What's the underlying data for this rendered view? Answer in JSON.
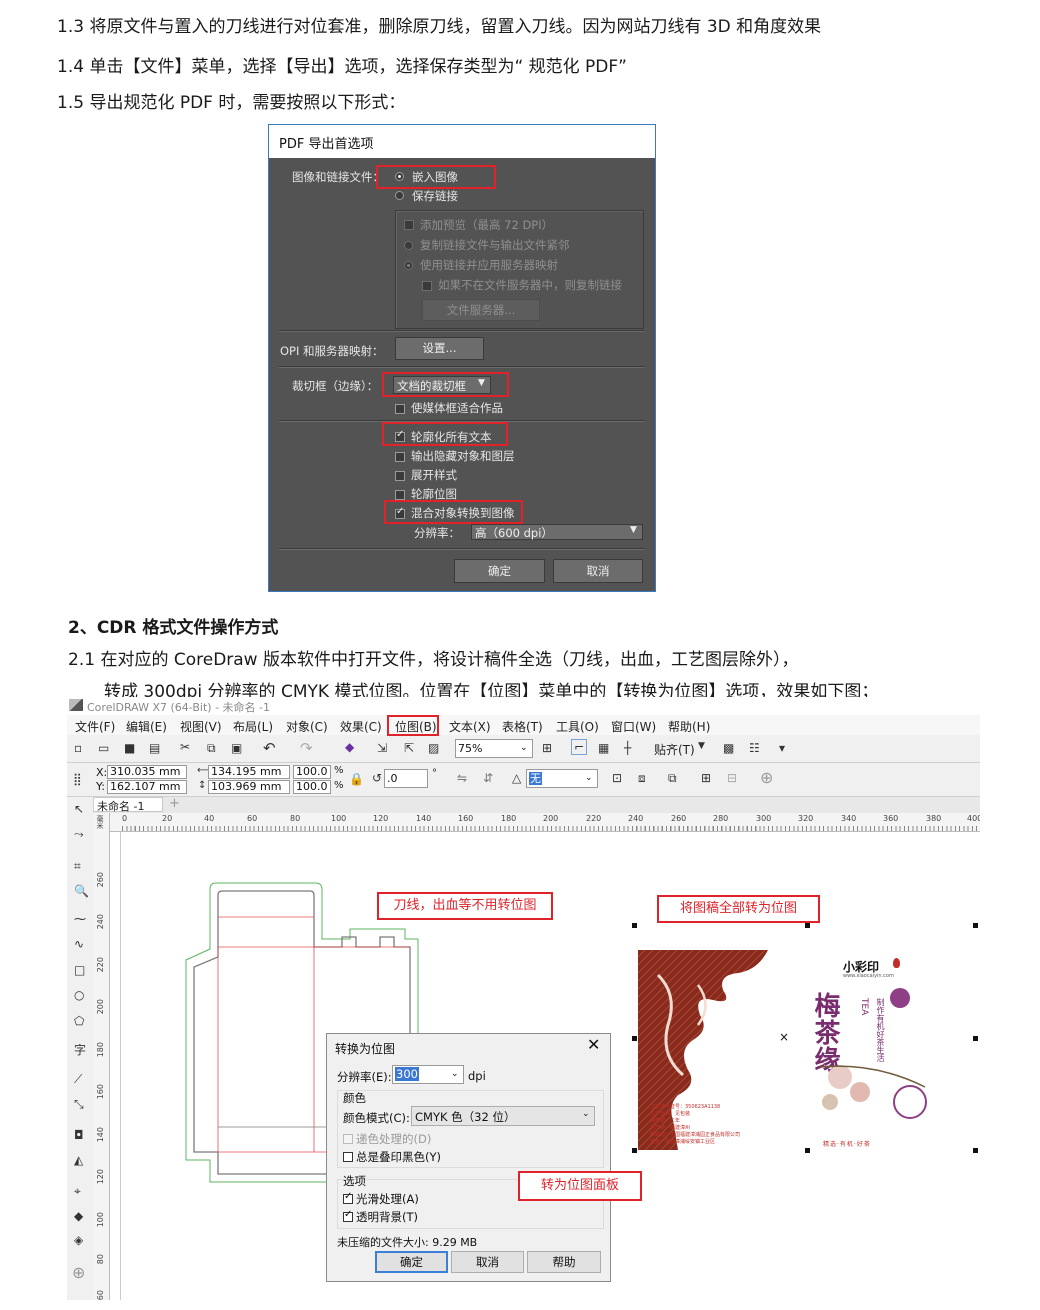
{
  "paragraphs": {
    "p1_3": "1.3 将原文件与置入的刀线进行对位套准，删除原刀线，留置入刀线。因为网站刀线有 3D 和角度效果",
    "p1_4": "1.4 单击【文件】菜单，选择【导出】选项，选择保存类型为“ 规范化 PDF”",
    "p1_5": "1.5 导出规范化 PDF 时，需要按照以下形式：",
    "heading2": "2、CDR 格式文件操作方式",
    "p2_1a": "2.1  在对应的 CoreDraw 版本软件中打开文件，将设计稿件全选（刀线，出血，工艺图层除外），",
    "p2_1b": "转成 300dpi 分辨率的 CMYK 模式位图。位置在【位图】菜单中的【转换为位图】选项，效果如下图；"
  },
  "pdf_dialog": {
    "title": "PDF 导出首选项",
    "image_link_label": "图像和链接文件：",
    "embed_images": "嵌入图像",
    "keep_links": "保存链接",
    "add_preview": "添加预览（最高 72 DPI）",
    "copy_linked": "复制链接文件与输出文件紧邻",
    "use_server_mapping": "使用链接并应用服务器映射",
    "copy_if_missing": "如果不在文件服务器中，则复制链接",
    "file_server_button": "文件服务器...",
    "opi_label": "OPI 和服务器映射：",
    "settings_button": "设置...",
    "trim_box_label": "裁切框（边缘）：",
    "trim_box_value": "文档的裁切框",
    "fit_media": "使媒体框适合作品",
    "outline_text": "轮廓化所有文本",
    "export_hidden": "输出隐藏对象和图层",
    "expand_styles": "展开样式",
    "outline_bitmaps": "轮廓位图",
    "convert_blend": "混合对象转换到图像",
    "resolution_label": "分辨率：",
    "resolution_value": "高（600 dpi）",
    "ok_button": "确定",
    "cancel_button": "取消"
  },
  "corel": {
    "window_title": "CorelDRAW X7 (64-Bit) - 未命名 -1",
    "menus": [
      "文件(F)",
      "编辑(E)",
      "视图(V)",
      "布局(L)",
      "对象(C)",
      "效果(C)",
      "位图(B)",
      "文本(X)",
      "表格(T)",
      "工具(O)",
      "窗口(W)",
      "帮助(H)"
    ],
    "zoom": "75%",
    "snap_label": "贴齐(T)",
    "x_label": "X:",
    "y_label": "Y:",
    "x_value": "310.035 mm",
    "y_value": "162.107 mm",
    "width_value": "134.195 mm",
    "height_value": "103.969 mm",
    "scale_w": "100.0",
    "scale_h": "100.0",
    "pct": "%",
    "rotation": ".0",
    "degree": "°",
    "outline_value": "无",
    "doc_tab": "未命名 -1",
    "ruler_unit": "毫米",
    "h_ruler": [
      "0",
      "20",
      "40",
      "60",
      "80",
      "100",
      "120",
      "140",
      "160",
      "180",
      "200",
      "220",
      "240",
      "260",
      "280",
      "300",
      "320",
      "340",
      "360",
      "380",
      "400"
    ],
    "v_ruler": [
      "260",
      "240",
      "220",
      "200",
      "180",
      "160",
      "140",
      "120",
      "100",
      "80",
      "60",
      "40"
    ],
    "note_dieline": "刀线，出血等不用转位图",
    "note_convert_all": "将图稿全部转为位图",
    "note_panel": "转为位图面板",
    "artwork": {
      "brand": "小彩印",
      "brand_url": "www.xiaocaiyin.com",
      "title_chars": "梅 茶 缘",
      "tea": "TEA",
      "side_text": "制作有机好茶生活",
      "info_lines": [
        "卫生许可证号：350623A1138",
        "生产日期：见包装",
        "保质期：二年",
        "生产商：福建漳州",
        "制造商：中国福建漳浦园正食品有限公司",
        "地址：福建漳浦绥安镇工业区"
      ],
      "footer_badges": "精选·有机·好茶"
    }
  },
  "convert_dialog": {
    "title": "转换为位图",
    "resolution_label": "分辨率(E):",
    "resolution_value": "300",
    "dpi": "dpi",
    "color_group": "颜色",
    "color_mode_label": "颜色模式(C):",
    "color_mode_value": "CMYK 色（32 位）",
    "dithered": "递色处理的(D)",
    "overprint_black": "总是叠印黑色(Y)",
    "options_group": "选项",
    "anti_alias": "光滑处理(A)",
    "transparent_bg": "透明背景(T)",
    "file_size": "未压缩的文件大小: 9.29 MB",
    "ok": "确定",
    "cancel": "取消",
    "help": "帮助"
  }
}
